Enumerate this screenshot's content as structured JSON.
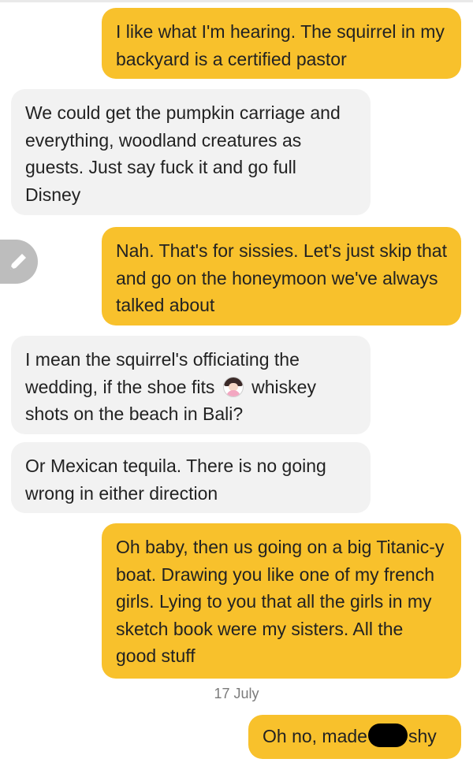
{
  "messages": [
    {
      "from": "me",
      "text": "I like what I'm hearing. The squirrel in my backyard is a certified pastor"
    },
    {
      "from": "them",
      "text": "We could get the pumpkin carriage and everything, woodland creatures as guests. Just say fuck it and go full Disney"
    },
    {
      "from": "me",
      "text": "Nah. That's for sissies. Let's just skip that and go on the honeymoon we've always talked about"
    },
    {
      "from": "them",
      "text_before_emoji": "I mean the squirrel's officiating the wedding, if the shoe fits",
      "emoji_icon": "woman-shrugging-emoji",
      "text_after_emoji": "whiskey shots on the beach in Bali?"
    },
    {
      "from": "them",
      "text": "Or Mexican tequila. There is no going wrong in either direction"
    },
    {
      "from": "me",
      "text": "Oh baby, then us going on a big Titanic-y boat. Drawing you like one of my french girls. Lying to you that all the girls in my sketch book were my sisters. All the good stuff"
    },
    {
      "from": "me",
      "text_before_redaction": "Oh no, made",
      "redaction": "redacted-name",
      "text_after_redaction": "shy"
    }
  ],
  "date_separator": "17 July",
  "edit_icon": "pencil-icon",
  "colors": {
    "outgoing_bubble": "#f8c12c",
    "incoming_bubble": "#f2f2f2",
    "text": "#222222",
    "date_text": "#7a7a7a",
    "edit_button": "#bdbdbd"
  }
}
